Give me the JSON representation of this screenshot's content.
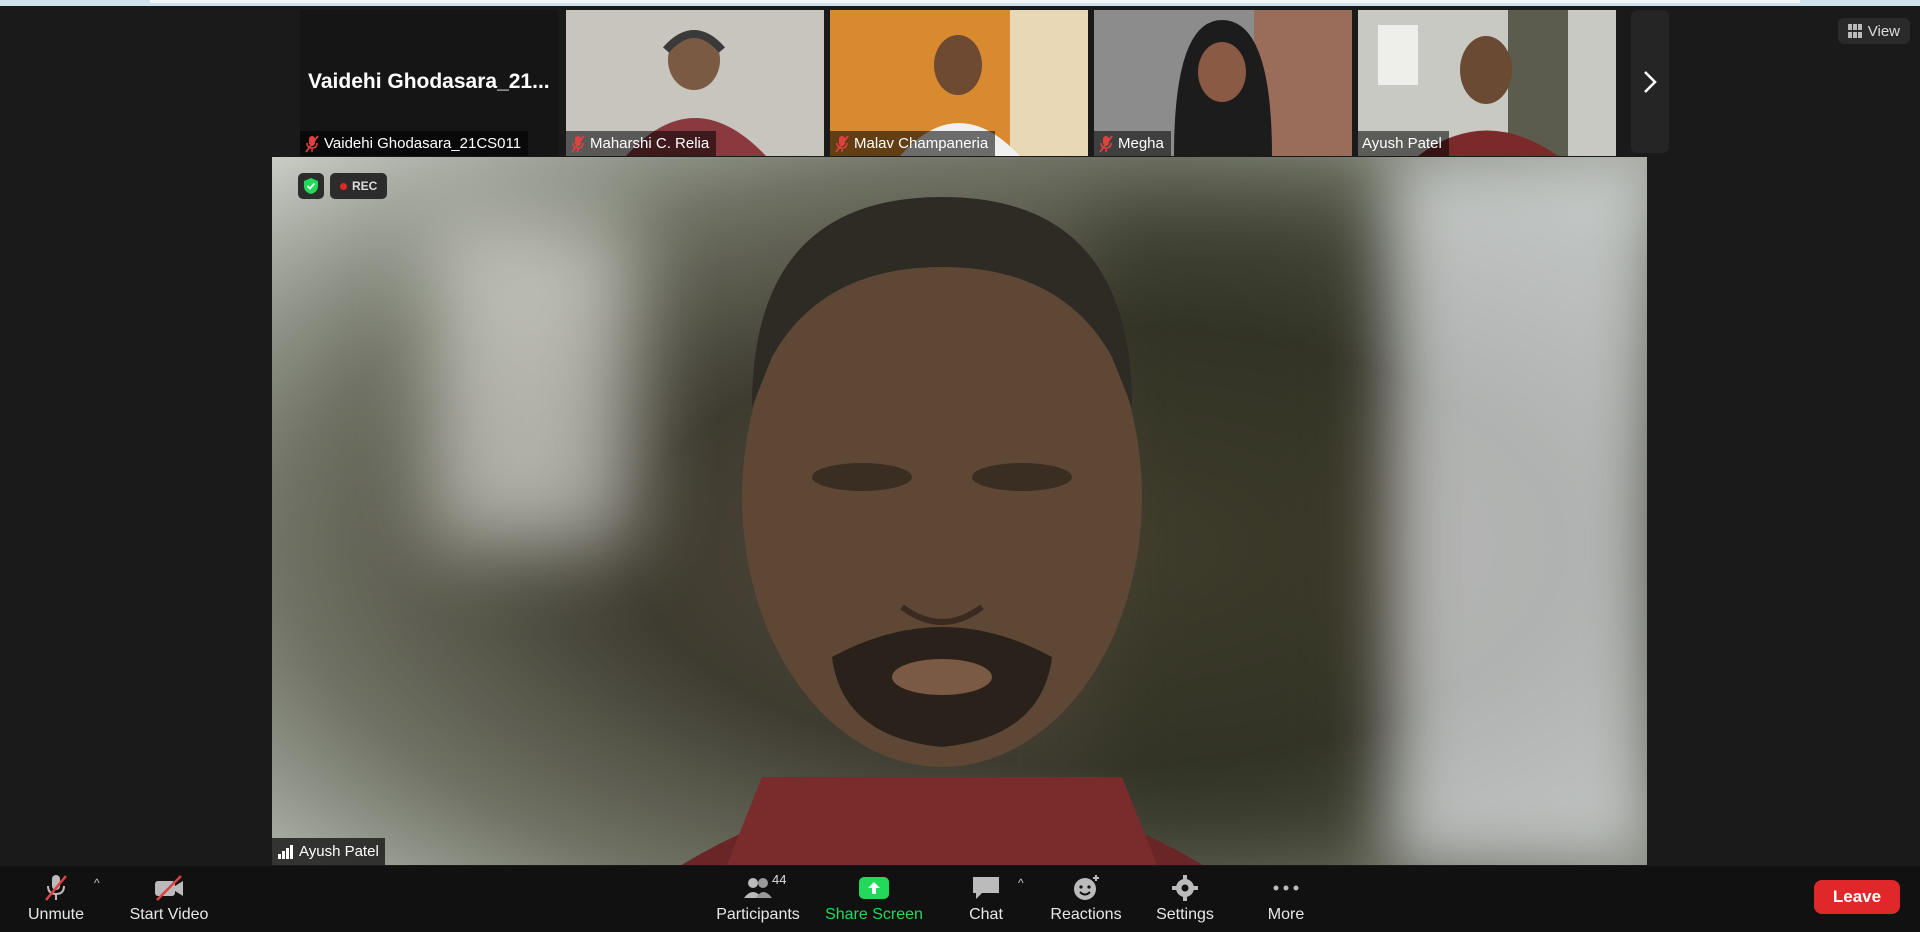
{
  "view_button": {
    "label": "View",
    "icon": "grid-view-icon"
  },
  "participants_strip": [
    {
      "big_name": "Vaidehi Ghodasara_21...",
      "name": "Vaidehi Ghodasara_21CS011",
      "muted": true,
      "type": "no-video"
    },
    {
      "name": "Maharshi C. Relia",
      "muted": true,
      "type": "video",
      "bg": "#b9b6b0"
    },
    {
      "name": "Malav Champaneria",
      "muted": true,
      "type": "video",
      "bg": "#d98a2e"
    },
    {
      "name": "Megha",
      "muted": true,
      "type": "video",
      "bg": "#8a8a8a"
    },
    {
      "name": "Ayush Patel",
      "muted": false,
      "type": "video",
      "bg": "#c9c9c4",
      "active": true
    }
  ],
  "next_page_icon": "chevron-right-icon",
  "stage": {
    "speaker_name": "Ayush Patel",
    "rec_label": "REC",
    "signal_icon": "signal-bars-icon",
    "security_icon": "shield-check-icon"
  },
  "toolbar": {
    "unmute": "Unmute",
    "start_video": "Start Video",
    "participants": "Participants",
    "participants_count": "44",
    "share_screen": "Share Screen",
    "chat": "Chat",
    "reactions": "Reactions",
    "settings": "Settings",
    "more": "More",
    "leave": "Leave",
    "caret": "^"
  },
  "colors": {
    "share_green": "#23d959",
    "leave_red": "#e0282b",
    "mute_red": "#e04040",
    "active_border": "#e7e79a"
  }
}
